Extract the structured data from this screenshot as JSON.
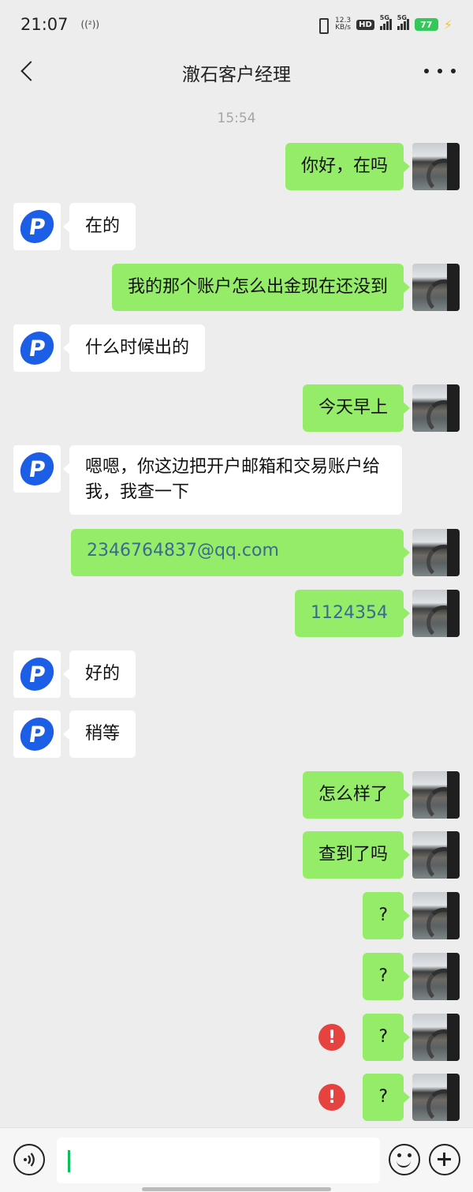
{
  "status_bar": {
    "time": "21:07",
    "hotspot": "((²))",
    "net_speed_value": "12.3",
    "net_speed_unit": "KB/s",
    "hd": "HD",
    "signal1_label": "5G",
    "signal2_label": "5G",
    "battery": "77"
  },
  "nav": {
    "title": "澈石客户经理"
  },
  "timestamp": "15:54",
  "messages": [
    {
      "from": "me",
      "text": "你好，在吗"
    },
    {
      "from": "them",
      "text": "在的"
    },
    {
      "from": "me",
      "text": "我的那个账户怎么出金现在还没到"
    },
    {
      "from": "them",
      "text": "什么时候出的"
    },
    {
      "from": "me",
      "text": "今天早上"
    },
    {
      "from": "them",
      "text": "嗯嗯，你这边把开户邮箱和交易账户给我，我查一下"
    },
    {
      "from": "me",
      "text": "2346764837@qq.com"
    },
    {
      "from": "me",
      "text": "1124354"
    },
    {
      "from": "them",
      "text": "好的"
    },
    {
      "from": "them",
      "text": "稍等"
    },
    {
      "from": "me",
      "text": "怎么样了"
    },
    {
      "from": "me",
      "text": "查到了吗"
    },
    {
      "from": "me",
      "text": "?"
    },
    {
      "from": "me",
      "text": "?"
    },
    {
      "from": "me",
      "text": "?",
      "failed": true
    },
    {
      "from": "me",
      "text": "?",
      "failed": true
    }
  ],
  "contact_avatar_letter": "P",
  "fail_mark": "!",
  "colors": {
    "outgoing_bubble": "#95ec69",
    "incoming_bubble": "#ffffff",
    "background": "#ededed",
    "fail": "#e64340",
    "logo": "#1d5ee6"
  },
  "icons": [
    "back-icon",
    "more-icon",
    "voice-icon",
    "emoji-icon",
    "plus-icon"
  ]
}
